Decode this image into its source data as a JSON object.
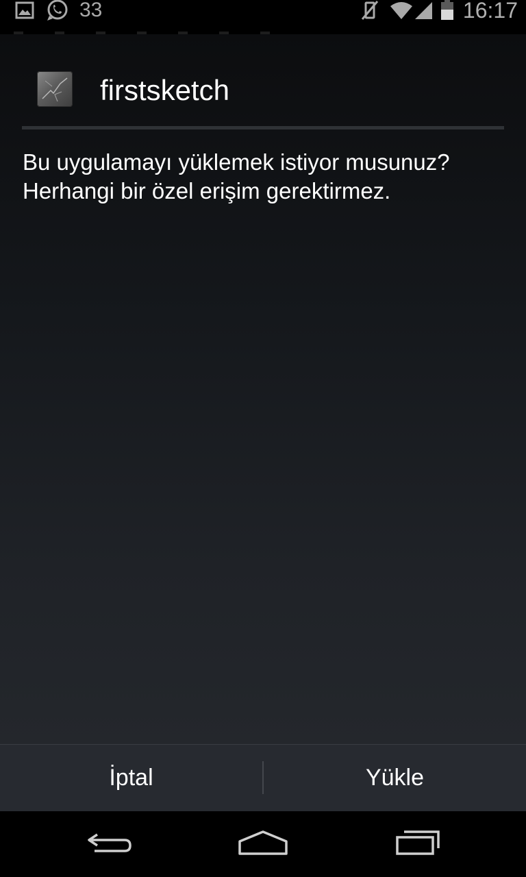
{
  "status_bar": {
    "notification_count": "33",
    "time": "16:17",
    "icons": [
      "image-icon",
      "whatsapp-icon",
      "vibrate-off-icon",
      "wifi-icon",
      "signal-icon",
      "battery-icon"
    ]
  },
  "dialog": {
    "app_name": "firstsketch",
    "message_line_1": "Bu uygulamayı yüklemek istiyor musunuz?",
    "message_line_2": "Herhangi bir özel erişim gerektirmez."
  },
  "buttons": {
    "cancel_label": "İptal",
    "install_label": "Yükle"
  },
  "nav_bar": {
    "icons": [
      "back-icon",
      "home-icon",
      "recents-icon"
    ]
  },
  "colors": {
    "background_top": "#0c0d0f",
    "background_bottom": "#24272c",
    "button_bar": "#272a30",
    "divider": "#2f3236",
    "status_text": "#a9a9a9"
  }
}
